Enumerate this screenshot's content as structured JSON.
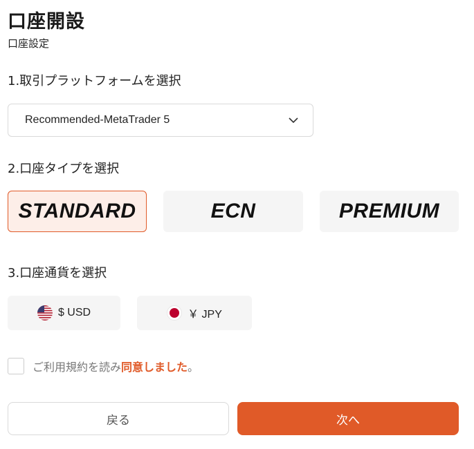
{
  "header": {
    "title": "口座開設",
    "subtitle": "口座設定"
  },
  "platform": {
    "label": "1.取引プラットフォームを選択",
    "selected": "Recommended-MetaTrader 5"
  },
  "account_type": {
    "label": "2.口座タイプを選択",
    "options": [
      "STANDARD",
      "ECN",
      "PREMIUM"
    ],
    "selected": "STANDARD"
  },
  "currency": {
    "label": "3.口座通貨を選択",
    "options": [
      {
        "label": "$ USD",
        "icon": "us-flag-icon"
      },
      {
        "label": "￥ JPY",
        "icon": "jp-flag-icon"
      }
    ]
  },
  "agreement": {
    "prefix": "ご利用規約を読み",
    "link": "同意しました",
    "suffix": "。"
  },
  "buttons": {
    "back": "戻る",
    "next": "次へ"
  },
  "colors": {
    "accent": "#e05a28",
    "card_bg": "#f5f5f5",
    "selected_bg": "#fdeee8"
  }
}
